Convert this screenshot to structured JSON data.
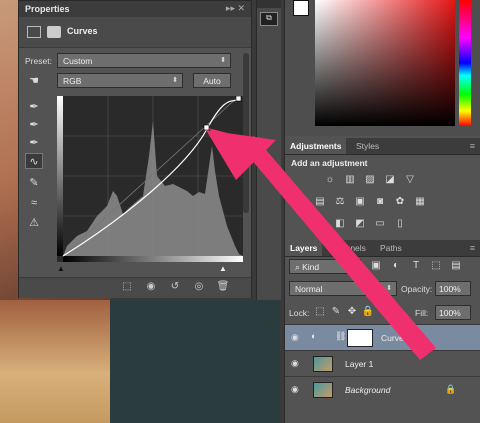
{
  "properties": {
    "title": "Properties",
    "panel_controls": "▸▸  ✕",
    "adjustment_name": "Curves",
    "preset_label": "Preset:",
    "preset_value": "Custom",
    "channel_value": "RGB",
    "auto_label": "Auto"
  },
  "tools": [
    "sample-in-image-black-icon",
    "sample-in-image-gray-icon",
    "sample-in-image-white-icon",
    "edit-points-curve-icon",
    "draw-pencil-icon",
    "smooth-curve-icon",
    "clipping-warning-icon"
  ],
  "curve": {
    "points": [
      [
        0,
        0
      ],
      [
        0.79,
        0.76
      ],
      [
        1,
        1
      ]
    ]
  },
  "footer_icons": [
    "clip-to-layer-icon",
    "view-previous-icon",
    "reset-icon",
    "visibility-icon",
    "delete-icon"
  ],
  "adjustments": {
    "tabs": [
      "Adjustments",
      "Styles"
    ],
    "heading": "Add an adjustment"
  },
  "layers": {
    "tabs": [
      "Layers",
      "Channels",
      "Paths"
    ],
    "filter_value": "Kind",
    "blend_mode": "Normal",
    "opacity_label": "Opacity:",
    "opacity_value": "100%",
    "lock_label": "Lock:",
    "fill_label": "Fill:",
    "fill_value": "100%",
    "items": [
      {
        "name": "Curves 1",
        "selected": true
      },
      {
        "name": "Layer 1",
        "selected": false
      },
      {
        "name": "Background",
        "selected": false,
        "italic": true
      }
    ]
  },
  "colors": {
    "accent_arrow": "#f0306e",
    "selected_layer": "#7a8aa0",
    "panel": "#535353"
  }
}
